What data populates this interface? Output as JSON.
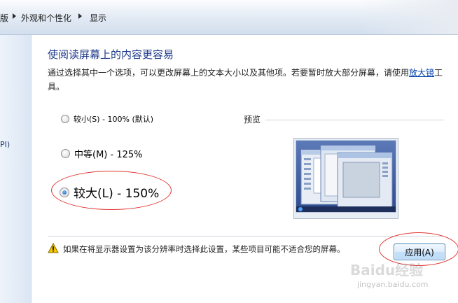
{
  "breadcrumb": {
    "partial_item": "版",
    "item_appearance": "外观和个性化",
    "item_display": "显示"
  },
  "left_pane": {
    "partial_text": "PI)"
  },
  "main": {
    "title": "使阅读屏幕上的内容更容易",
    "desc_before_link": "通过选择其中一个选项，可以更改屏幕上的文本大小以及其他项。若要暂时放大部分屏幕，请使用",
    "desc_link": "放大镜",
    "desc_after_link": "工具。",
    "options": {
      "small": {
        "label": "较小(S) - 100% (默认)",
        "checked": false
      },
      "medium": {
        "label": "中等(M) - 125%",
        "checked": false
      },
      "large": {
        "label": "较大(L) - 150%",
        "checked": true
      }
    },
    "preview_label": "预览",
    "warning_text": "如果在将显示器设置为该分辨率时选择此设置，某些项目可能不适合您的屏幕。",
    "apply_label": "应用(A)"
  },
  "watermark": {
    "brand": "Baidu经验",
    "url": "jingyan.baidu.com"
  },
  "colors": {
    "title_blue": "#1e3a8a",
    "link_blue": "#0645ad",
    "annotation_red": "#e0322f"
  }
}
